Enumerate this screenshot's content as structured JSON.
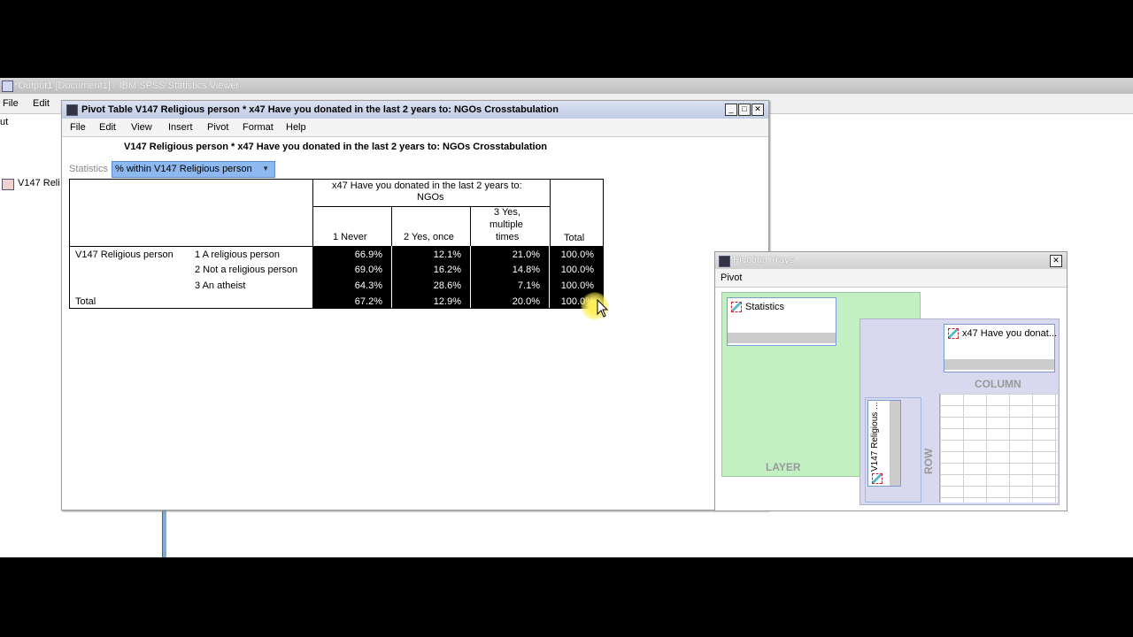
{
  "viewer": {
    "title": "*Output1 [Document1] - IBM SPSS Statistics Viewer",
    "menu": [
      "File",
      "Edit"
    ],
    "left_fragment": "ut",
    "outline_item": "V147 Reli"
  },
  "pivot_window": {
    "title": "Pivot Table V147 Religious person * x47 Have you donated in the last 2 years to: NGOs Crosstabulation",
    "menu": [
      "File",
      "Edit",
      "View",
      "Insert",
      "Pivot",
      "Format",
      "Help"
    ],
    "table_title": "V147 Religious person * x47 Have you donated in the last 2 years to: NGOs Crosstabulation",
    "statistics_label": "Statistics",
    "statistics_selected": "% within V147 Religious person"
  },
  "crosstab": {
    "col_header_group_l1": "x47 Have you donated in the last 2 years to:",
    "col_header_group_l2": "NGOs",
    "columns": [
      "1 Never",
      "2 Yes, once",
      "Total"
    ],
    "col3_l1": "3 Yes,",
    "col3_l2": "multiple",
    "col3_l3": "times",
    "row_var": "V147 Religious person",
    "rows": [
      {
        "label": "1 A religious person",
        "values": [
          "66.9%",
          "12.1%",
          "21.0%",
          "100.0%"
        ]
      },
      {
        "label": "2 Not a religious person",
        "values": [
          "69.0%",
          "16.2%",
          "14.8%",
          "100.0%"
        ]
      },
      {
        "label": "3 An atheist",
        "values": [
          "64.3%",
          "28.6%",
          "7.1%",
          "100.0%"
        ]
      }
    ],
    "total_label": "Total",
    "total_values": [
      "67.2%",
      "12.9%",
      "20.0%",
      "100.0%"
    ]
  },
  "trays": {
    "title": "Pivoting Trays",
    "menu": "Pivot",
    "layer_chip": "Statistics",
    "layer_label": "LAYER",
    "column_chip": "x47 Have you donat...",
    "column_label": "COLUMN",
    "row_chip": "V147 Religious ...",
    "row_label": "ROW"
  }
}
